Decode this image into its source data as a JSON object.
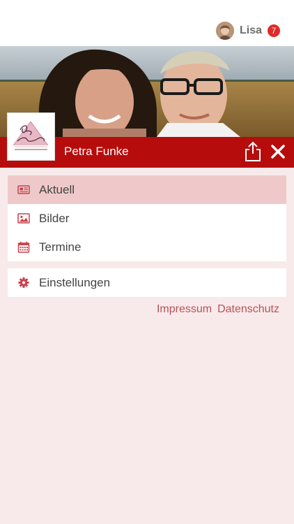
{
  "user": {
    "name": "Lisa",
    "notifications": "7",
    "avatar_icon": "user-avatar"
  },
  "header": {
    "title": "Petra Funke",
    "logo_text": "Petra Funke",
    "logo_subtext": "MODE • WÄSCHE • ACCESSOIRES",
    "share_icon": "share-icon",
    "close_icon": "close-icon"
  },
  "menu": {
    "items": [
      {
        "label": "Aktuell",
        "icon": "newspaper-icon",
        "active": true
      },
      {
        "label": "Bilder",
        "icon": "image-icon",
        "active": false
      },
      {
        "label": "Termine",
        "icon": "calendar-icon",
        "active": false
      }
    ],
    "settings": {
      "label": "Einstellungen",
      "icon": "gear-icon"
    }
  },
  "footer_links": {
    "impressum": "Impressum",
    "datenschutz": "Datenschutz"
  },
  "colors": {
    "brand": "#b70c0c",
    "background": "#f8eaea",
    "active_item": "#efc9c9",
    "icon": "#c9424c",
    "link": "#b8525a",
    "badge": "#e02a2a"
  }
}
